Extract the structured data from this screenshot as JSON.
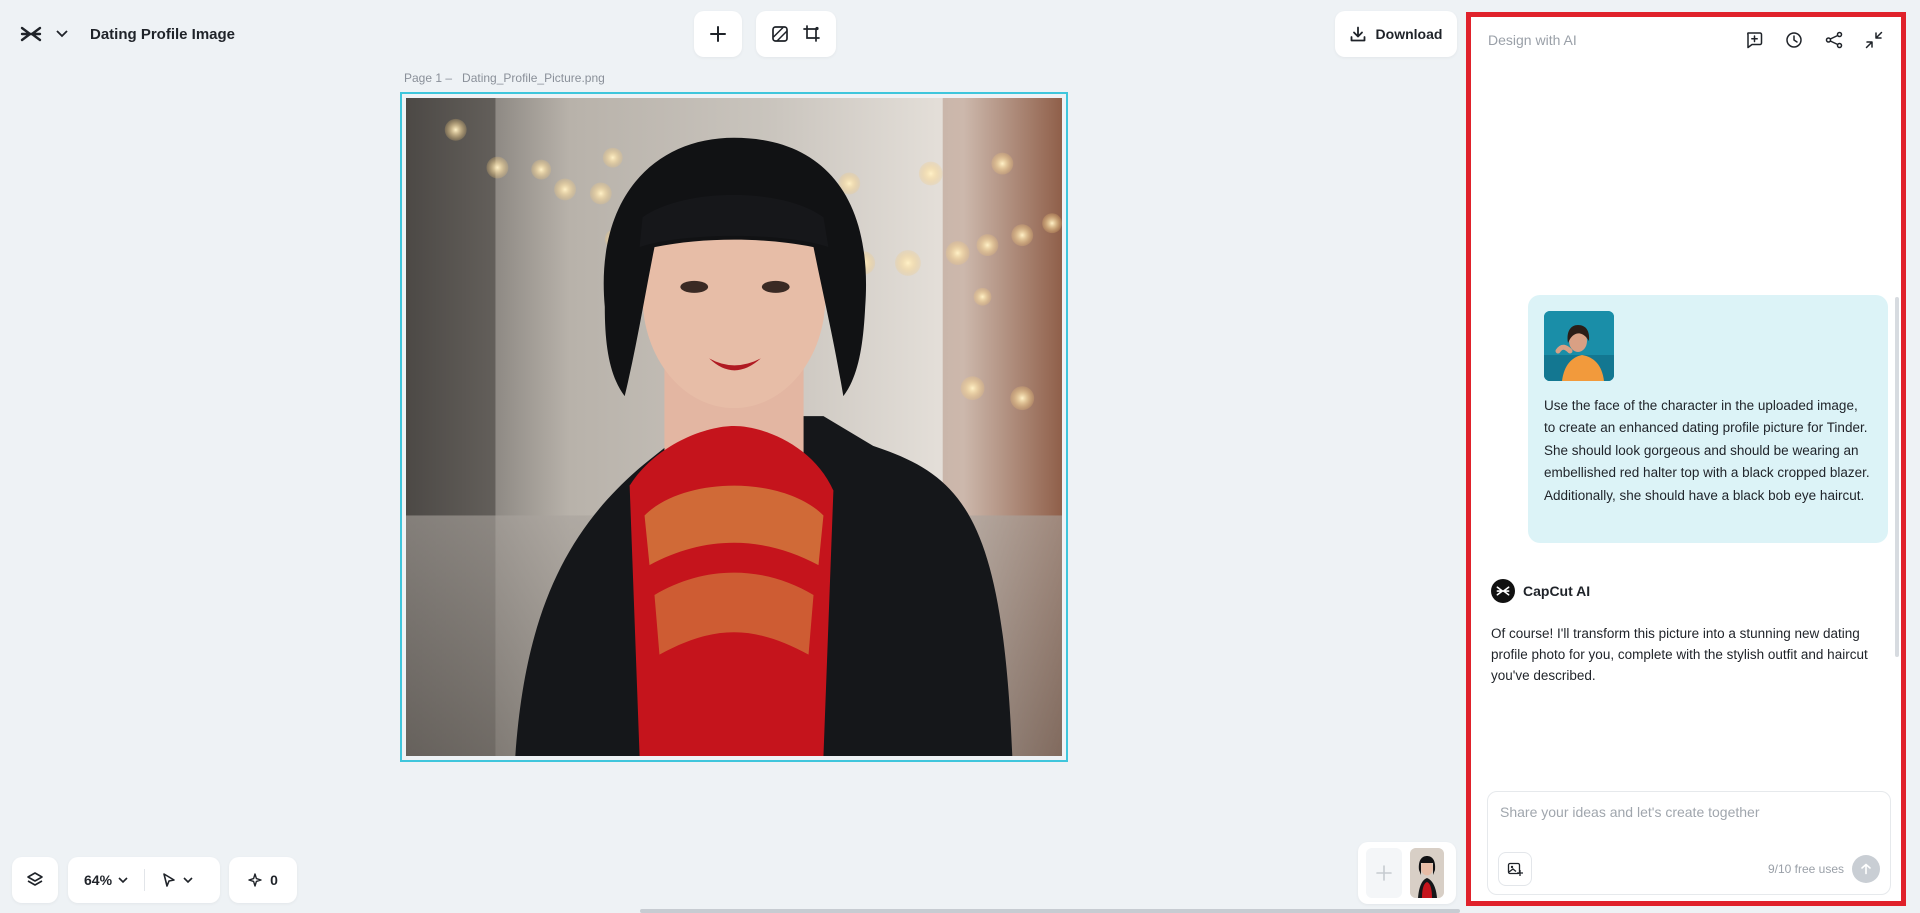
{
  "app": {
    "title": "Dating Profile Image"
  },
  "toolbar": {
    "add_icon": "plus-icon",
    "remove_bg_icon": "remove-background-icon",
    "crop_icon": "crop-icon",
    "download_label": "Download"
  },
  "canvas": {
    "page_label": "Page 1 –",
    "file_name": "Dating_Profile_Picture.png",
    "selection_color": "#3fc6dc"
  },
  "bottom_bar": {
    "zoom": "64%",
    "credits": "0"
  },
  "ai_panel": {
    "title": "Design with AI",
    "border_color": "#e0222b",
    "user_message": "Use the face of the character in the uploaded image, to create an enhanced dating profile picture for Tinder. She should look gorgeous and should be wearing an embellished red halter top with a black cropped blazer. Additionally, she should have a black bob eye haircut.",
    "assistant_name": "CapCut AI",
    "assistant_message": "Of course! I'll transform this picture into a stunning new dating profile photo for you, complete with the stylish outfit and haircut you've described.",
    "composer": {
      "placeholder": "Share your ideas and let's create together",
      "free_uses": "9/10 free uses"
    }
  },
  "colors": {
    "background": "#eef2f5",
    "user_bubble": "#dcf3f7"
  }
}
